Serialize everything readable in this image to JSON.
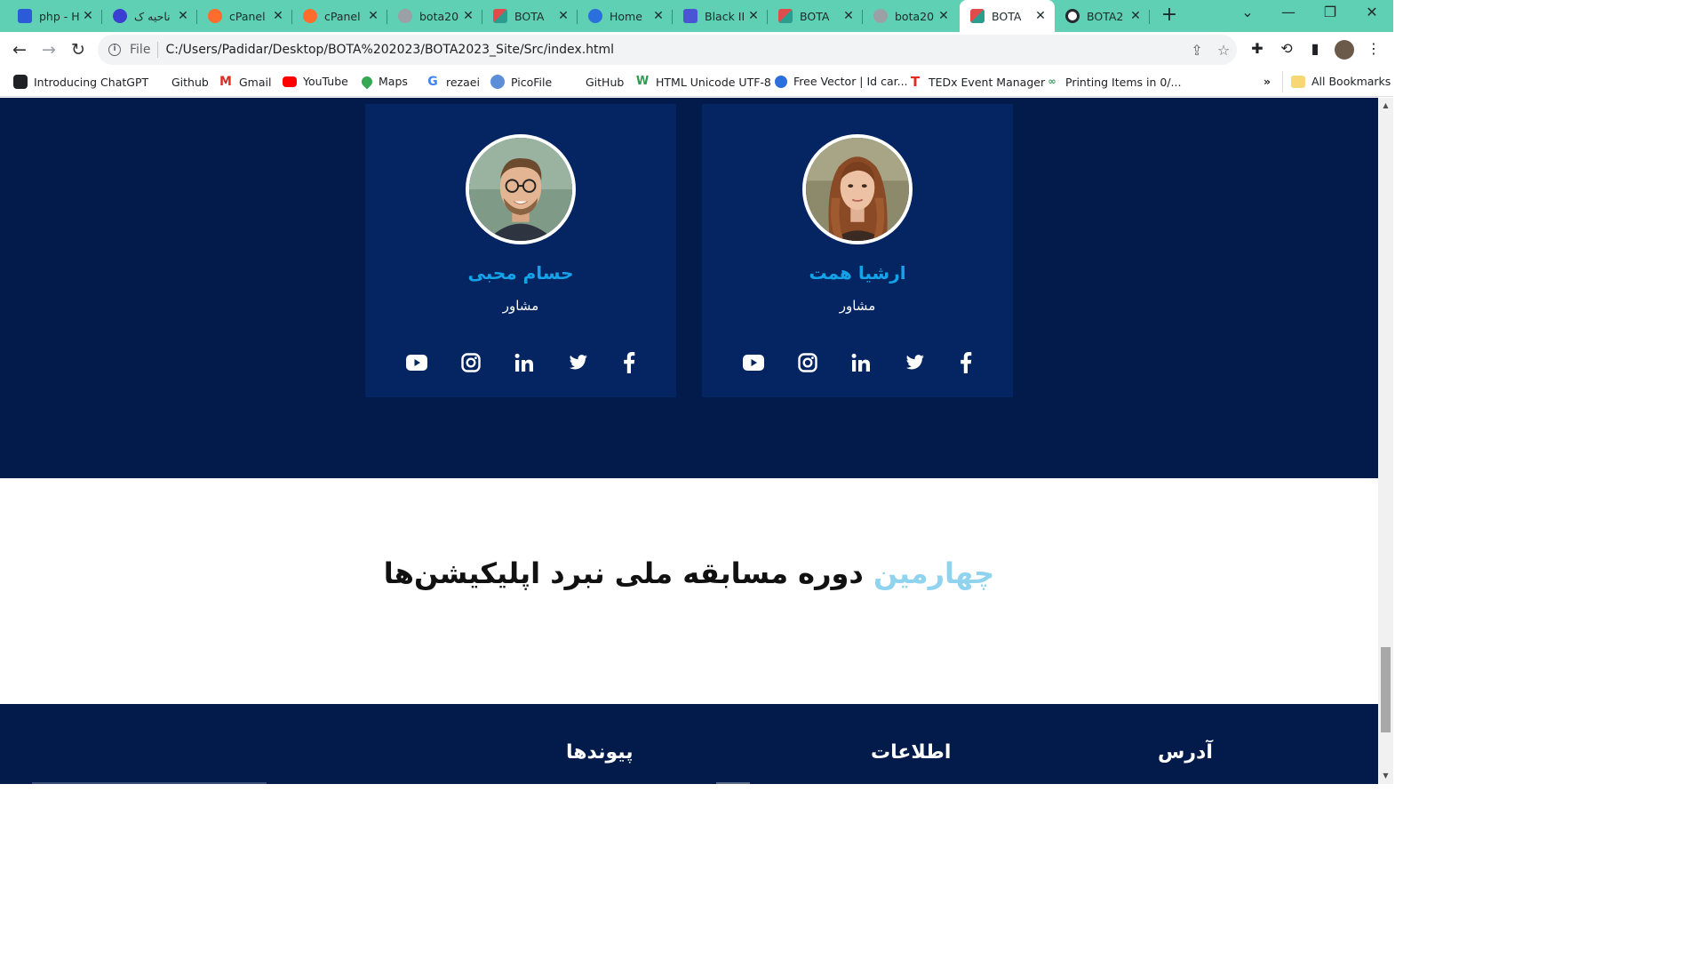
{
  "browser": {
    "tabs": [
      {
        "title": "php - H",
        "favicon_color": "#2b5bd7"
      },
      {
        "title": "ناحیه ک",
        "favicon_color": "#3a3fd1"
      },
      {
        "title": "cPanel",
        "favicon_color": "#ff6c2c"
      },
      {
        "title": "cPanel",
        "favicon_color": "#ff6c2c"
      },
      {
        "title": "bota20",
        "favicon_color": "#9aa0a6"
      },
      {
        "title": "BOTA",
        "favicon_color": "#e04c4c"
      },
      {
        "title": "Home",
        "favicon_color": "#2a6fdb"
      },
      {
        "title": "Black II",
        "favicon_color": "#4a55d6"
      },
      {
        "title": "BOTA",
        "favicon_color": "#e04c4c"
      },
      {
        "title": "bota20",
        "favicon_color": "#9aa0a6"
      },
      {
        "title": "BOTA",
        "favicon_color": "#e04c4c",
        "active": true
      },
      {
        "title": "BOTA2",
        "favicon_color": "#24292f"
      }
    ],
    "new_tab_label": "+",
    "window_controls": {
      "list": "⌄",
      "minimize": "—",
      "restore": "❐",
      "close": "✕"
    },
    "nav": {
      "back": "←",
      "forward": "→",
      "reload": "↻"
    },
    "omnibox": {
      "scheme_label": "File",
      "url": "C:/Users/Padidar/Desktop/BOTA%202023/BOTA2023_Site/Src/index.html"
    },
    "bookmarks": [
      {
        "label": "Introducing ChatGPT",
        "icon_color": "#202124"
      },
      {
        "label": "Github",
        "icon_color": "#ffffff"
      },
      {
        "label": "Gmail",
        "icon_color": "#d93025"
      },
      {
        "label": "YouTube",
        "icon_color": "#ff0000"
      },
      {
        "label": "Maps",
        "icon_color": "#34a853"
      },
      {
        "label": "rezaei",
        "icon_color": "#4285f4"
      },
      {
        "label": "PicoFile",
        "icon_color": "#5b8dd9"
      },
      {
        "label": "GitHub",
        "icon_color": "#ffffff"
      },
      {
        "label": "HTML Unicode UTF-8",
        "icon_color": "#2e9c4f"
      },
      {
        "label": "Free Vector | Id car...",
        "icon_color": "#2a6fdb"
      },
      {
        "label": "TEDx Event Manager",
        "icon_color": "#e62b1e"
      },
      {
        "label": "Printing Items in 0/...",
        "icon_color": "#3a9a5c"
      }
    ],
    "bookmarks_overflow": "»",
    "all_bookmarks_label": "All Bookmarks"
  },
  "page": {
    "team": [
      {
        "name": "حسام محبی",
        "role": "مشاور",
        "avatar_subject": "man-with-glasses"
      },
      {
        "name": "ارشیا همت",
        "role": "مشاور",
        "avatar_subject": "woman-long-hair"
      }
    ],
    "social_icons": [
      "youtube-icon",
      "instagram-icon",
      "linkedin-icon",
      "twitter-icon",
      "facebook-icon"
    ],
    "headline": {
      "highlight": "چهارمین",
      "rest": " دوره مسابقه ملی نبرد اپلیکیشن‌ها"
    },
    "footer_headings": [
      "آدرس",
      "اطلاعات",
      "پیوندها"
    ],
    "colors": {
      "dark_navy": "#021b4a",
      "card_blue": "#042562",
      "name_blue": "#14a3e8",
      "highlight_light_blue": "#8fd3ee",
      "tab_strip_green": "#5fd0b4"
    }
  }
}
